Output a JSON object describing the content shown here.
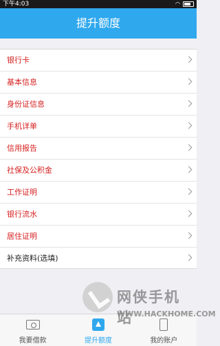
{
  "status_bar": {
    "time": "下午4:03"
  },
  "header": {
    "title": "提升额度"
  },
  "list": {
    "items": [
      {
        "label": "银行卡",
        "color": "#d62020"
      },
      {
        "label": "基本信息",
        "color": "#d62020"
      },
      {
        "label": "身份证信息",
        "color": "#d62020"
      },
      {
        "label": "手机详单",
        "color": "#d62020"
      },
      {
        "label": "信用报告",
        "color": "#d62020"
      },
      {
        "label": "社保及公积金",
        "color": "#d62020"
      },
      {
        "label": "工作证明",
        "color": "#d62020"
      },
      {
        "label": "银行流水",
        "color": "#d62020"
      },
      {
        "label": "居住证明",
        "color": "#d62020"
      },
      {
        "label": "补充资料(选填)",
        "color": "#222222"
      }
    ]
  },
  "tabbar": {
    "tabs": [
      {
        "label": "我要借款",
        "icon": "money-icon"
      },
      {
        "label": "提升额度",
        "icon": "upgrade-icon",
        "active": true
      },
      {
        "label": "我的账户",
        "icon": "account-icon"
      }
    ]
  },
  "watermark": {
    "text": "网侠手机站",
    "url": "WWW.HACKHOME.COM"
  },
  "colors": {
    "accent": "#2fa8ee",
    "required_label": "#d62020"
  }
}
